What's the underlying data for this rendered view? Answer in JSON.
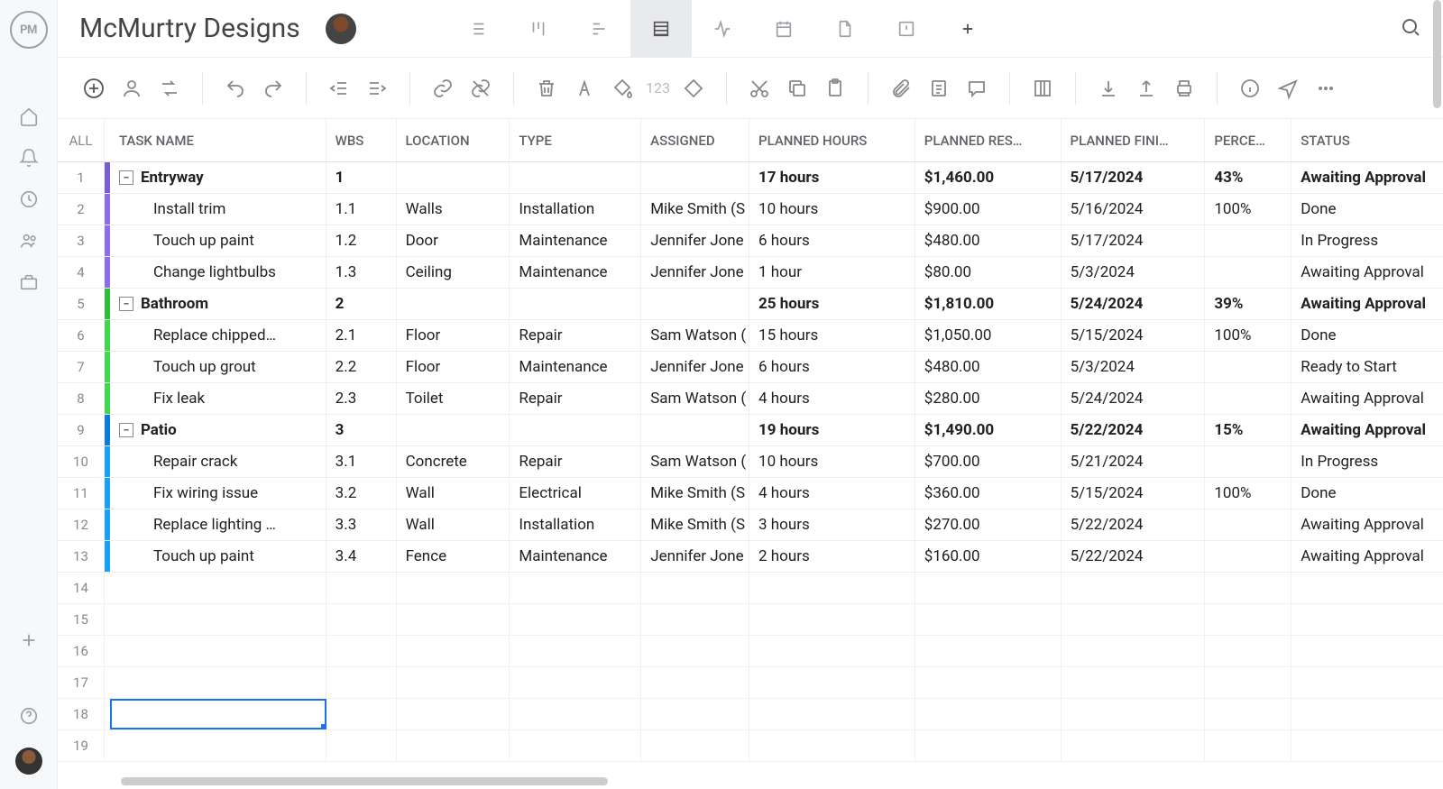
{
  "project_title": "McMurtry Designs",
  "logo_text": "PM",
  "columns": {
    "rownum": "ALL",
    "task": "TASK NAME",
    "wbs": "WBS",
    "loc": "LOCATION",
    "type": "TYPE",
    "assign": "ASSIGNED",
    "hours": "PLANNED HOURS",
    "cost": "PLANNED RES…",
    "finish": "PLANNED FINI…",
    "percent": "PERCE…",
    "status": "STATUS"
  },
  "rows": [
    {
      "n": "1",
      "group": true,
      "color": "#7a5fd1",
      "task": "Entryway",
      "wbs": "1",
      "loc": "",
      "type": "",
      "assign": "",
      "hours": "17 hours",
      "cost": "$1,460.00",
      "finish": "5/17/2024",
      "percent": "43%",
      "status": "Awaiting Approval"
    },
    {
      "n": "2",
      "group": false,
      "color": "#8c6fe6",
      "task": "Install trim",
      "wbs": "1.1",
      "loc": "Walls",
      "type": "Installation",
      "assign": "Mike Smith (S",
      "hours": "10 hours",
      "cost": "$900.00",
      "finish": "5/16/2024",
      "percent": "100%",
      "status": "Done"
    },
    {
      "n": "3",
      "group": false,
      "color": "#8c6fe6",
      "task": "Touch up paint",
      "wbs": "1.2",
      "loc": "Door",
      "type": "Maintenance",
      "assign": "Jennifer Jone",
      "hours": "6 hours",
      "cost": "$480.00",
      "finish": "5/17/2024",
      "percent": "",
      "status": "In Progress"
    },
    {
      "n": "4",
      "group": false,
      "color": "#8c6fe6",
      "task": "Change lightbulbs",
      "wbs": "1.3",
      "loc": "Ceiling",
      "type": "Maintenance",
      "assign": "Jennifer Jone",
      "hours": "1 hour",
      "cost": "$80.00",
      "finish": "5/3/2024",
      "percent": "",
      "status": "Awaiting Approval"
    },
    {
      "n": "5",
      "group": true,
      "color": "#2dbf3c",
      "task": "Bathroom",
      "wbs": "2",
      "loc": "",
      "type": "",
      "assign": "",
      "hours": "25 hours",
      "cost": "$1,810.00",
      "finish": "5/24/2024",
      "percent": "39%",
      "status": "Awaiting Approval"
    },
    {
      "n": "6",
      "group": false,
      "color": "#3fd84f",
      "task": "Replace chipped…",
      "wbs": "2.1",
      "loc": "Floor",
      "type": "Repair",
      "assign": "Sam Watson (",
      "hours": "15 hours",
      "cost": "$1,050.00",
      "finish": "5/15/2024",
      "percent": "100%",
      "status": "Done"
    },
    {
      "n": "7",
      "group": false,
      "color": "#3fd84f",
      "task": "Touch up grout",
      "wbs": "2.2",
      "loc": "Floor",
      "type": "Maintenance",
      "assign": "Jennifer Jone",
      "hours": "6 hours",
      "cost": "$480.00",
      "finish": "5/3/2024",
      "percent": "",
      "status": "Ready to Start"
    },
    {
      "n": "8",
      "group": false,
      "color": "#3fd84f",
      "task": "Fix leak",
      "wbs": "2.3",
      "loc": "Toilet",
      "type": "Repair",
      "assign": "Sam Watson (",
      "hours": "4 hours",
      "cost": "$280.00",
      "finish": "5/24/2024",
      "percent": "",
      "status": "Awaiting Approval"
    },
    {
      "n": "9",
      "group": true,
      "color": "#0b7dd6",
      "task": "Patio",
      "wbs": "3",
      "loc": "",
      "type": "",
      "assign": "",
      "hours": "19 hours",
      "cost": "$1,490.00",
      "finish": "5/22/2024",
      "percent": "15%",
      "status": "Awaiting Approval"
    },
    {
      "n": "10",
      "group": false,
      "color": "#1a9ff5",
      "task": "Repair crack",
      "wbs": "3.1",
      "loc": "Concrete",
      "type": "Repair",
      "assign": "Sam Watson (",
      "hours": "10 hours",
      "cost": "$700.00",
      "finish": "5/21/2024",
      "percent": "",
      "status": "In Progress"
    },
    {
      "n": "11",
      "group": false,
      "color": "#1a9ff5",
      "task": "Fix wiring issue",
      "wbs": "3.2",
      "loc": "Wall",
      "type": "Electrical",
      "assign": "Mike Smith (S",
      "hours": "4 hours",
      "cost": "$360.00",
      "finish": "5/15/2024",
      "percent": "100%",
      "status": "Done"
    },
    {
      "n": "12",
      "group": false,
      "color": "#1a9ff5",
      "task": "Replace lighting …",
      "wbs": "3.3",
      "loc": "Wall",
      "type": "Installation",
      "assign": "Mike Smith (S",
      "hours": "3 hours",
      "cost": "$270.00",
      "finish": "5/22/2024",
      "percent": "",
      "status": "Awaiting Approval"
    },
    {
      "n": "13",
      "group": false,
      "color": "#1a9ff5",
      "task": "Touch up paint",
      "wbs": "3.4",
      "loc": "Fence",
      "type": "Maintenance",
      "assign": "Jennifer Jone",
      "hours": "2 hours",
      "cost": "$160.00",
      "finish": "5/22/2024",
      "percent": "",
      "status": "Awaiting Approval"
    }
  ],
  "empty_rows": [
    "14",
    "15",
    "16",
    "17",
    "18",
    "19"
  ],
  "active_row": "18",
  "toolbar_num": "123"
}
